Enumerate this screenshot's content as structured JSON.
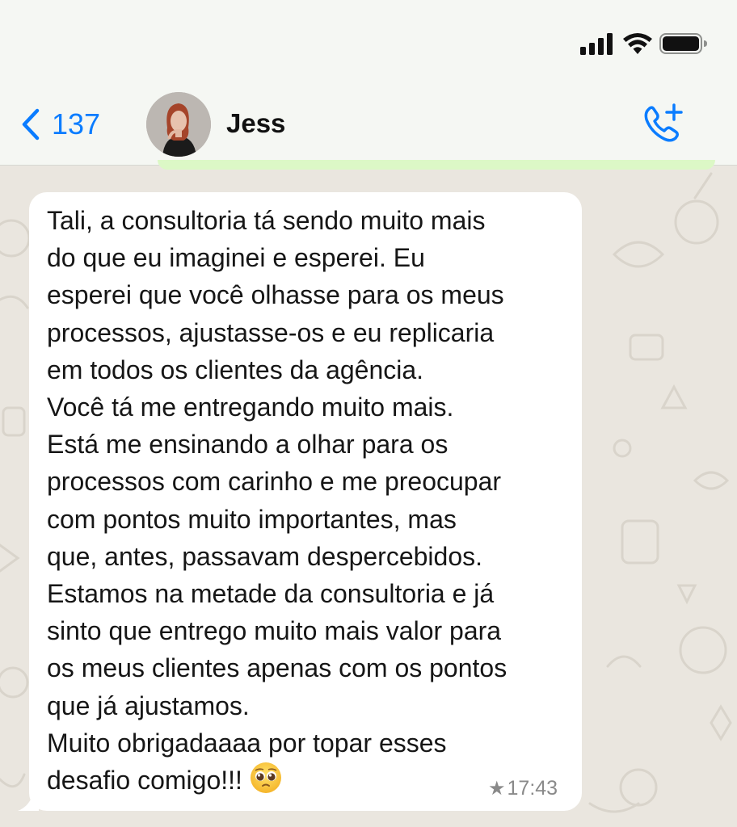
{
  "status_bar": {
    "signal_icon": "cellular-signal-icon",
    "wifi_icon": "wifi-icon",
    "battery_icon": "battery-icon"
  },
  "header": {
    "back_icon": "chevron-left-icon",
    "back_count": "137",
    "contact_name": "Jess",
    "avatar": "contact-photo",
    "call_icon": "add-call-icon"
  },
  "message": {
    "direction": "incoming",
    "text_main": "Tali, a consultoria tá sendo muito mais\ndo que eu imaginei e esperei. Eu\nesperei que você olhasse para os meus\nprocessos, ajustasse-os e eu replicaria\nem todos os clientes da agência.\nVocê tá me entregando muito mais.\nEstá me ensinando a olhar para os\nprocessos com carinho e me preocupar\ncom pontos muito importantes, mas\nque, antes, passavam despercebidos.\nEstamos na metade da consultoria e já\nsinto que entrego muito mais valor para\nos meus clientes apenas com os pontos\nque já ajustamos.\nMuito obrigadaaaa por topar esses\ndesafio comigo!!! ",
    "emoji": "pleading-face-emoji",
    "starred_icon": "star-icon",
    "star_glyph": "★",
    "time": "17:43"
  },
  "colors": {
    "ios_blue": "#0a7cff",
    "wallpaper": "#eae6df",
    "header_bg": "#f5f7f3",
    "bubble_bg": "#ffffff",
    "outgoing_bubble": "#dcf8c6",
    "meta_grey": "#8a8a8a"
  }
}
